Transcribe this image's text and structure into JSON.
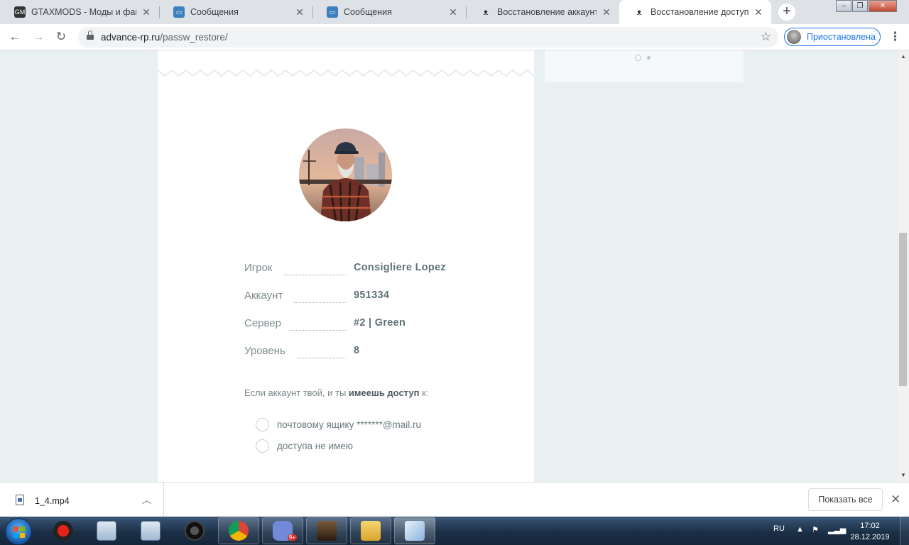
{
  "browser": {
    "tabs": [
      {
        "title": "GTAXMODS - Моды и файлы",
        "favicon": "gtaxmods-icon",
        "active": false
      },
      {
        "title": "Сообщения",
        "favicon": "chat-icon",
        "active": false
      },
      {
        "title": "Сообщения",
        "favicon": "chat-icon",
        "active": false
      },
      {
        "title": "Восстановление аккаунтов",
        "favicon": "advance-rp-icon",
        "active": false
      },
      {
        "title": "Восстановление доступа | A",
        "favicon": "advance-rp-icon",
        "active": true
      }
    ],
    "new_tab_label": "+",
    "address": {
      "host": "advance-rp.ru",
      "path": "/passw_restore/"
    },
    "profile_label": "Приостановлена"
  },
  "page": {
    "player": {
      "fields": [
        {
          "label": "Игрок",
          "value": "Consigliere  Lopez"
        },
        {
          "label": "Аккаунт",
          "value": "951334"
        },
        {
          "label": "Сервер",
          "value": "#2 | Green"
        },
        {
          "label": "Уровень",
          "value": "8"
        }
      ]
    },
    "access_question": {
      "before": "Если аккаунт твой, и ты ",
      "bold": "имеешь доступ",
      "after": " к:"
    },
    "options": [
      {
        "label": "почтовому ящику *******@mail.ru",
        "checked": false
      },
      {
        "label": "доступа не имею",
        "checked": false
      }
    ]
  },
  "downloads": {
    "file_name": "1_4.mp4",
    "show_all_label": "Показать все"
  },
  "taskbar": {
    "language": "RU",
    "time": "17:02",
    "date": "28.12.2019",
    "discord_badge": "9+"
  },
  "colors": {
    "page_bg": "#e8f0f1",
    "value_text": "#5f7379",
    "label_text": "#7f8c90",
    "profile_accent": "#1a73e8"
  }
}
